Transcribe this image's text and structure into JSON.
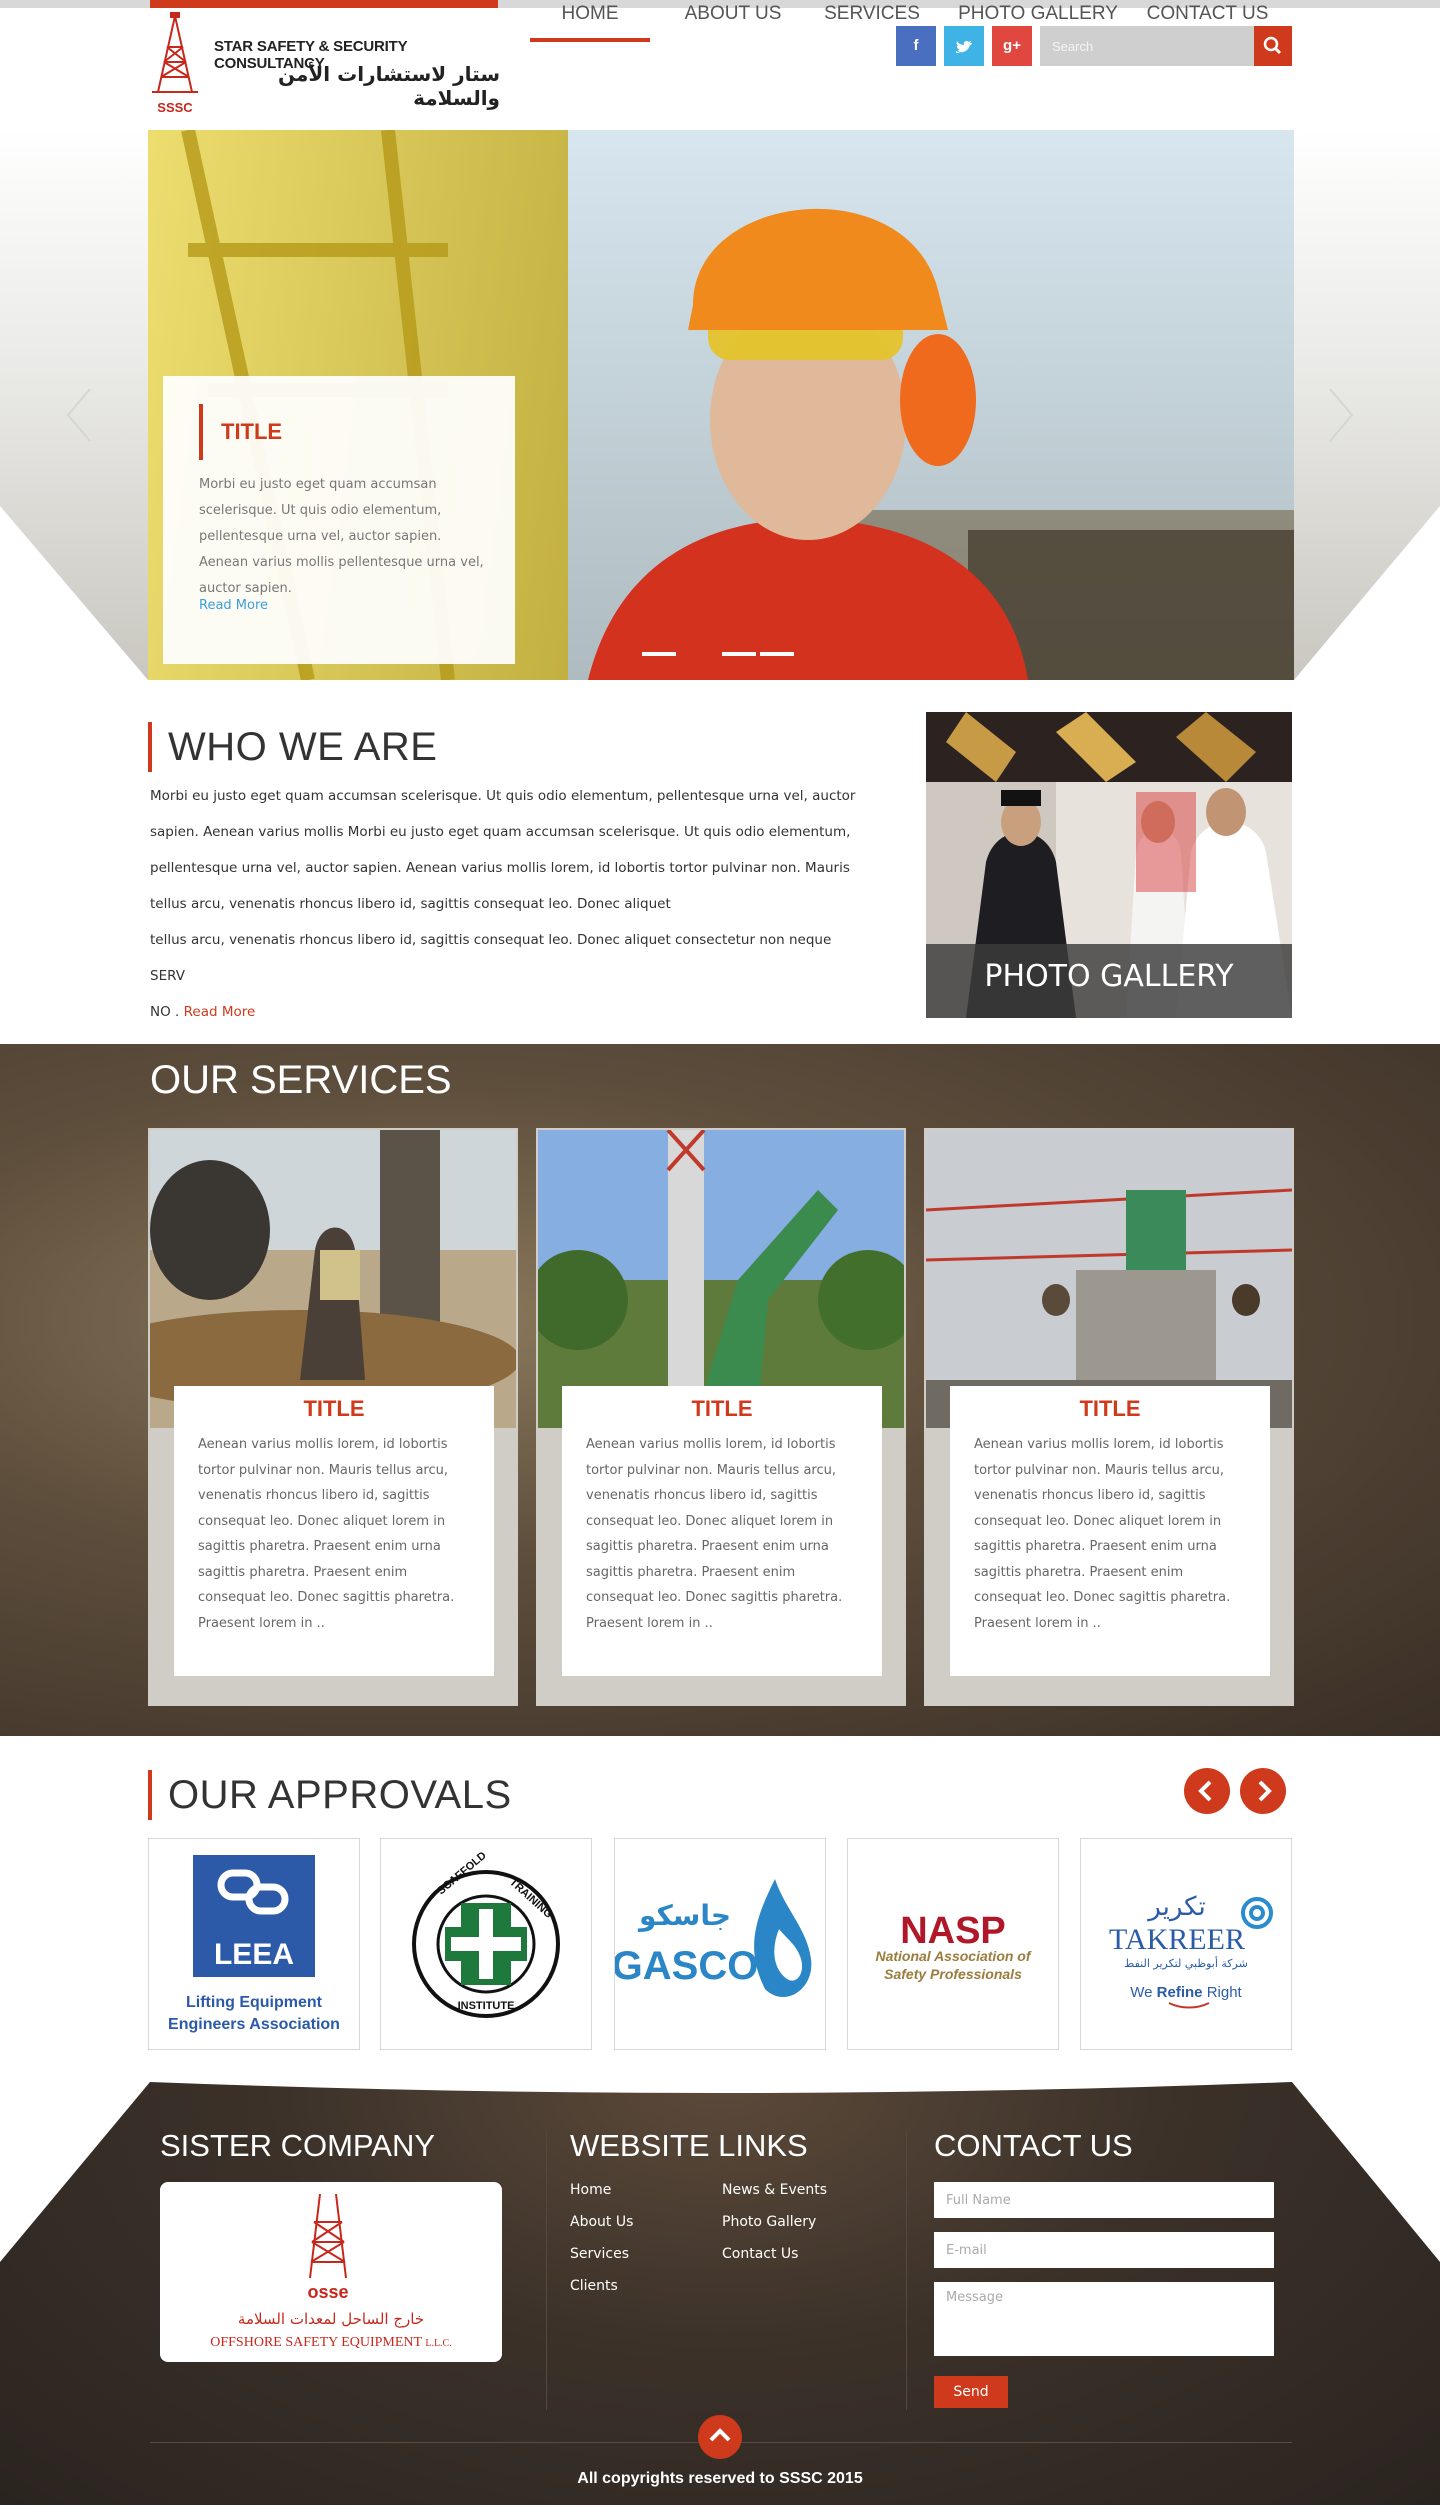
{
  "logo": {
    "text_en": "STAR SAFETY & SECURITY CONSULTANCY",
    "text_ar": "ستار لاستشارات الأمن والسلامة",
    "abbr": "SSSC"
  },
  "social": {
    "facebook": "f",
    "twitter": "t",
    "googleplus": "g+"
  },
  "search": {
    "placeholder": "Search"
  },
  "nav": {
    "items": [
      "HOME",
      "ABOUT US",
      "SERVICES",
      "PHOTO GALLERY",
      "CONTACT US"
    ],
    "active": "HOME"
  },
  "hero": {
    "title": "TITLE",
    "text": "Morbi eu justo eget quam accumsan scelerisque. Ut quis odio elementum, pellentesque urna vel, auctor sapien. Aenean varius mollis pellentesque urna vel, auctor sapien.",
    "read_more": "Read More"
  },
  "who": {
    "title": "WHO WE ARE",
    "lines": [
      "Morbi eu justo eget quam accumsan scelerisque. Ut quis odio elementum, pellentesque urna vel, auctor",
      "sapien. Aenean varius mollis Morbi eu justo eget quam accumsan scelerisque. Ut quis odio elementum,",
      "pellentesque urna vel, auctor sapien. Aenean varius mollis lorem, id lobortis tortor pulvinar non. Mauris",
      "tellus arcu, venenatis rhoncus libero id, sagittis consequat leo. Donec aliquet",
      "tellus arcu, venenatis rhoncus libero id, sagittis consequat leo. Donec aliquet consectetur non neque SERV",
      "NO ."
    ],
    "read_more": "Read More"
  },
  "gallery": {
    "caption": "PHOTO GALLERY"
  },
  "services": {
    "title": "OUR SERVICES",
    "items": [
      {
        "title": "TITLE",
        "text": "Aenean varius mollis lorem, id lobortis tortor pulvinar non. Mauris tellus arcu, venenatis rhoncus libero id, sagittis consequat leo. Donec aliquet lorem in sagittis pharetra. Praesent enim urna sagittis pharetra. Praesent enim consequat leo. Donec sagittis pharetra. Praesent lorem in .."
      },
      {
        "title": "TITLE",
        "text": "Aenean varius mollis lorem, id lobortis tortor pulvinar non. Mauris tellus arcu, venenatis rhoncus libero id, sagittis consequat leo. Donec aliquet lorem in sagittis pharetra. Praesent enim urna sagittis pharetra. Praesent enim consequat leo. Donec sagittis pharetra. Praesent lorem in .."
      },
      {
        "title": "TITLE",
        "text": "Aenean varius mollis lorem, id lobortis tortor pulvinar non. Mauris tellus arcu, venenatis rhoncus libero id, sagittis consequat leo. Donec aliquet lorem in sagittis pharetra. Praesent enim urna sagittis pharetra. Praesent enim consequat leo. Donec sagittis pharetra. Praesent lorem in .."
      }
    ]
  },
  "approvals": {
    "title": "OUR APPROVALS",
    "leea": {
      "name": "LEEA",
      "line1": "Lifting Equipment",
      "line2": "Engineers Association"
    },
    "scaffold": {
      "top": "SCAFFOLD",
      "right": "TRAINING",
      "bottom": "INSTITUTE"
    },
    "gasco": {
      "ar": "جاسكو",
      "en": "GASCO"
    },
    "nasp": {
      "name": "NASP",
      "line1": "National Association of",
      "line2": "Safety Professionals"
    },
    "takreer": {
      "ar": "تكرير",
      "en": "TAKREER",
      "sub_ar": "شركة أبوظبي لتكرير النفط",
      "tag_pre": "We",
      "tag_mid": "Refine",
      "tag_post": "Right"
    }
  },
  "footer": {
    "sister": {
      "title": "SISTER COMPANY",
      "abbr": "osse",
      "ar": "خارج الساحل لمعدات السلامة",
      "en": "OFFSHORE SAFETY EQUIPMENT",
      "suffix": "L.L.C."
    },
    "links": {
      "title": "WEBSITE LINKS",
      "col1": [
        "Home",
        "About Us",
        "Services",
        "Clients"
      ],
      "col2": [
        "News & Events",
        "Photo Gallery",
        "Contact Us"
      ]
    },
    "contact": {
      "title": "CONTACT US",
      "name_placeholder": "Full Name",
      "email_placeholder": "E-mail",
      "message_placeholder": "Message",
      "send": "Send"
    },
    "copyright": "All copyrights reserved to SSSC 2015"
  },
  "colors": {
    "accent": "#d03a1c",
    "facebook": "#4a6fc0",
    "twitter": "#3fb2e6",
    "googleplus": "#e0473f",
    "link_blue": "#3aa0d8"
  }
}
